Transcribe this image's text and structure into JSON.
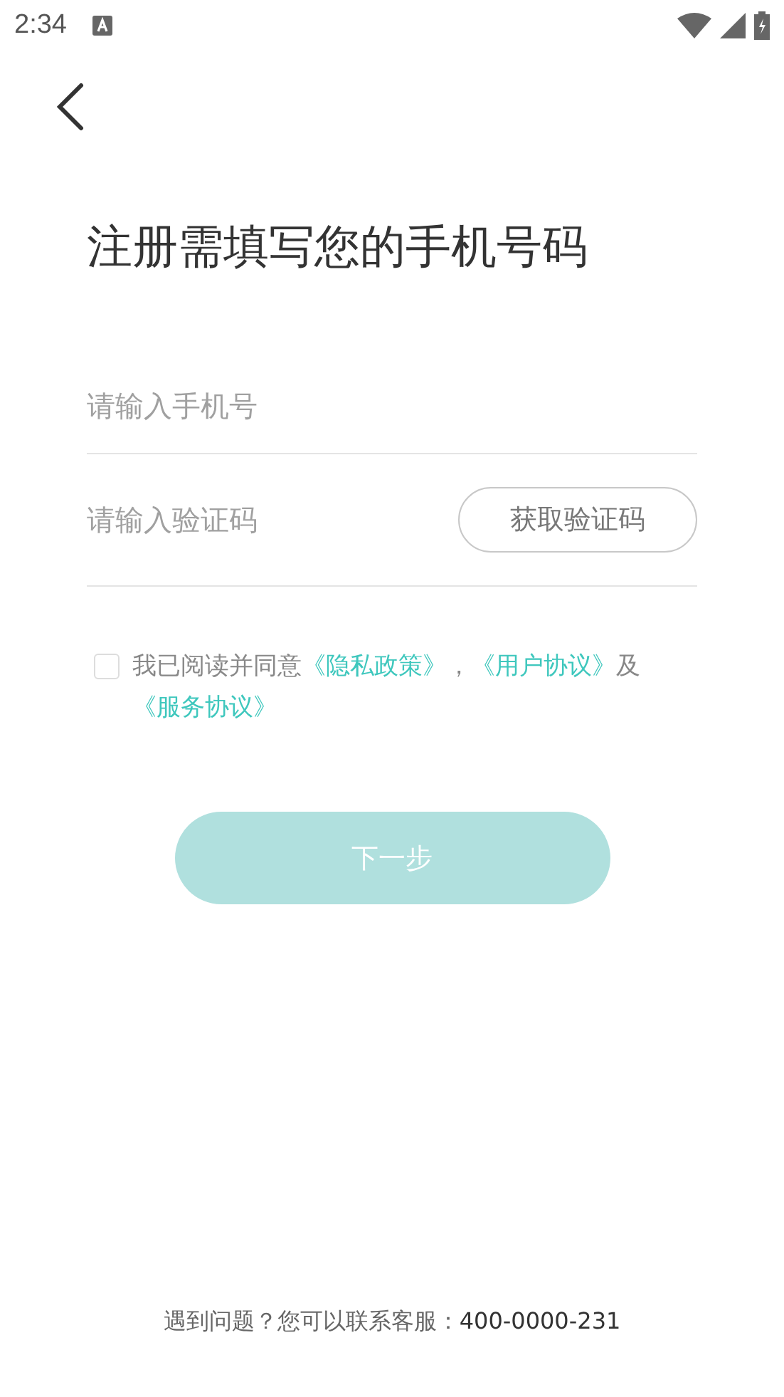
{
  "status_bar": {
    "time": "2:34"
  },
  "title": "注册需填写您的手机号码",
  "phone_field": {
    "placeholder": "请输入手机号"
  },
  "code_field": {
    "placeholder": "请输入验证码"
  },
  "get_code_button": "获取验证码",
  "agreement": {
    "checked": false,
    "parts": [
      {
        "kind": "text",
        "text": "我已阅读并同意"
      },
      {
        "kind": "link",
        "text": "《隐私政策》"
      },
      {
        "kind": "text",
        "text": "，"
      },
      {
        "kind": "link",
        "text": "《用户协议》"
      },
      {
        "kind": "text",
        "text": "及"
      },
      {
        "kind": "link",
        "text": "《服务协议》"
      }
    ]
  },
  "next_button": {
    "label": "下一步",
    "disabled": true
  },
  "footer": {
    "text": "遇到问题？您可以联系客服：",
    "phone": "400-0000-231"
  }
}
